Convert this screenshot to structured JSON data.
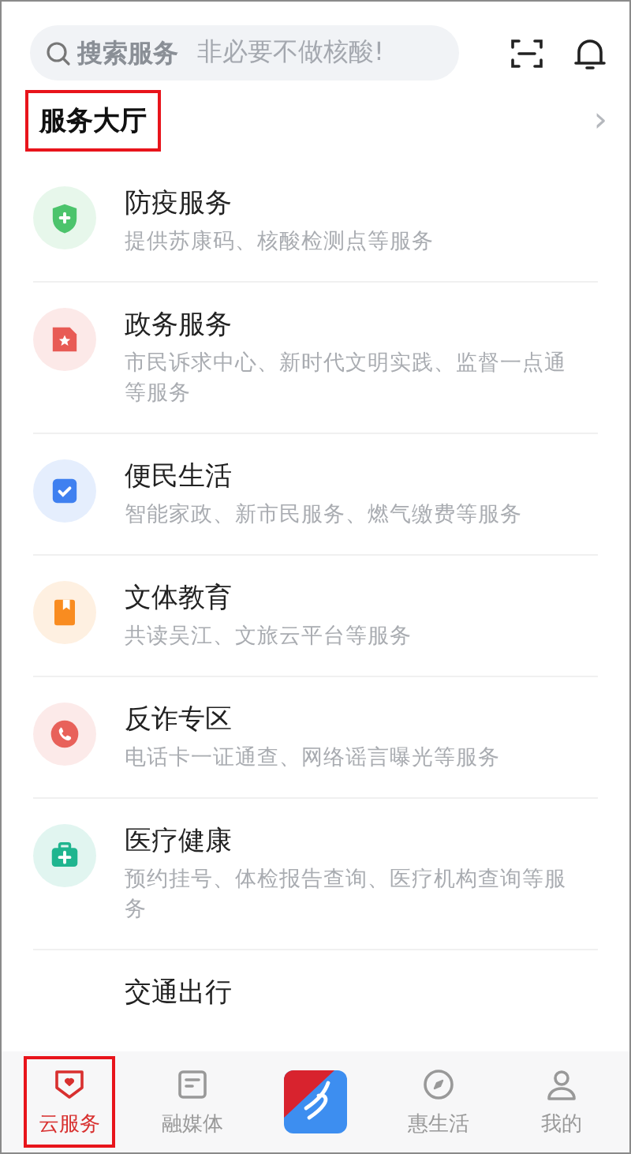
{
  "search": {
    "placeholder": "搜索服务",
    "notice": "非必要不做核酸!"
  },
  "section": {
    "title": "服务大厅",
    "highlighted": true,
    "more": "›"
  },
  "services": [
    {
      "title": "防疫服务",
      "subtitle": "提供苏康码、核酸检测点等服务",
      "kind": "shield",
      "color": "#4cc46c"
    },
    {
      "title": "政务服务",
      "subtitle": "市民诉求中心、新时代文明实践、监督一点通等服务",
      "kind": "document",
      "color": "#e85b55"
    },
    {
      "title": "便民生活",
      "subtitle": "智能家政、新市民服务、燃气缴费等服务",
      "kind": "check",
      "color": "#3f80f0"
    },
    {
      "title": "文体教育",
      "subtitle": "共读吴江、文旅云平台等服务",
      "kind": "book",
      "color": "#f98c20"
    },
    {
      "title": "反诈专区",
      "subtitle": "电话卡一证通查、网络谣言曝光等服务",
      "kind": "phone",
      "color": "#e8615a"
    },
    {
      "title": "医疗健康",
      "subtitle": "预约挂号、体检报告查询、医疗机构查询等服务",
      "kind": "medkit",
      "color": "#1fb58f"
    },
    {
      "title": "交通出行",
      "kind": "hidden"
    }
  ],
  "tabs": [
    {
      "label": "云服务",
      "kind": "heart",
      "selected": true,
      "highlighted": true
    },
    {
      "label": "融媒体",
      "kind": "doc",
      "selected": false,
      "highlighted": false
    },
    {
      "kind": "logo",
      "selected": false,
      "highlighted": false
    },
    {
      "label": "惠生活",
      "kind": "compass",
      "selected": false,
      "highlighted": false
    },
    {
      "label": "我的",
      "kind": "person",
      "selected": false,
      "highlighted": false
    }
  ]
}
